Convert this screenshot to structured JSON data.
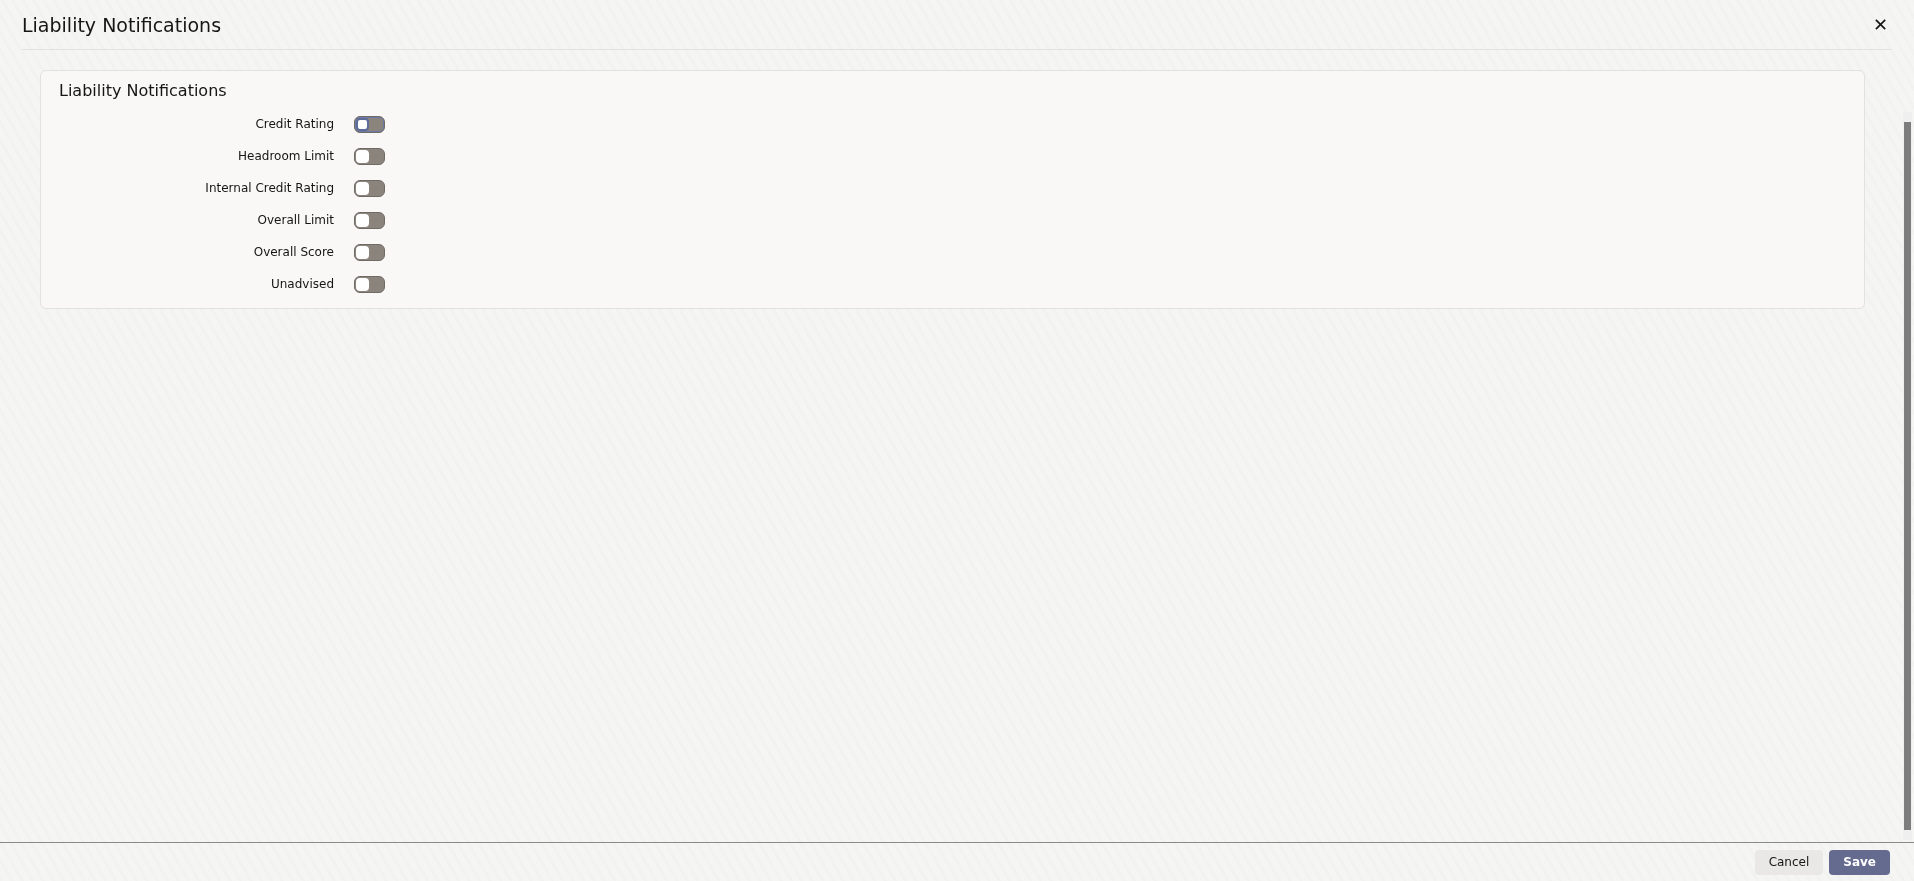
{
  "window": {
    "title": "Liability Notifications",
    "close": "✕"
  },
  "section": {
    "title": "Liability Notifications",
    "toggles": [
      {
        "label": "Credit Rating",
        "on": false,
        "focused": true
      },
      {
        "label": "Headroom Limit",
        "on": false,
        "focused": false
      },
      {
        "label": "Internal Credit Rating",
        "on": false,
        "focused": false
      },
      {
        "label": "Overall Limit",
        "on": false,
        "focused": false
      },
      {
        "label": "Overall Score",
        "on": false,
        "focused": false
      },
      {
        "label": "Unadvised",
        "on": false,
        "focused": false
      }
    ]
  },
  "buttons": [
    {
      "label": "Cancel",
      "kind": "secondary"
    },
    {
      "label": "Save",
      "kind": "primary"
    }
  ]
}
